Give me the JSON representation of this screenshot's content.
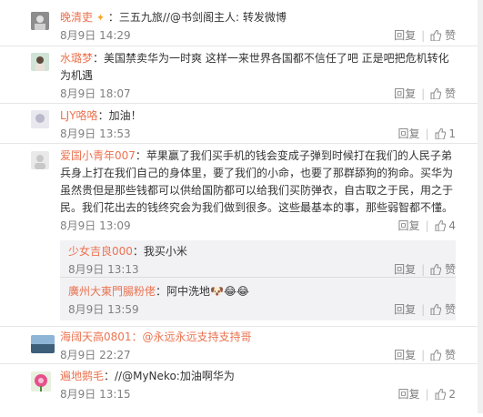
{
  "comments": [
    {
      "user": "晚清吏",
      "badge": "✦",
      "text": "：三五九旅//@书剑阁主人: 转发微博",
      "time": "8月9日 14:29",
      "reply": "回复",
      "like": "赞",
      "like_count": ""
    },
    {
      "user": "水璐梦",
      "badge": "",
      "text": "：美国禁卖华为一时爽 这样一来世界各国都不信任了吧 正是吧把危机转化为机遇",
      "time": "8月9日 18:07",
      "reply": "回复",
      "like": "赞",
      "like_count": ""
    },
    {
      "user": "LJY咯咯",
      "badge": "",
      "text": "：加油！",
      "time": "8月9日 13:53",
      "reply": "回复",
      "like": "",
      "like_count": "1"
    },
    {
      "user": "爱国小青年007",
      "badge": "",
      "text": "：苹果赢了我们买手机的钱会变成子弹到时候打在我们的人民子弟兵身上打在我们自己的身体里，要了我们的小命，也要了那群舔狗的狗命。买华为虽然贵但是那些钱都可以供给国防都可以给我们买防弹衣，自古取之于民，用之于民。我们花出去的钱终究会为我们做到很多。这些最基本的事，那些弱智都不懂。",
      "time": "8月9日 13:09",
      "reply": "回复",
      "like": "",
      "like_count": "4"
    },
    {
      "user": "海阔天高0801",
      "badge": "",
      "text": "：@永远永远支持支持哥",
      "time": "8月9日 22:27",
      "reply": "回复",
      "like": "赞",
      "like_count": ""
    },
    {
      "user": "遍地鹅毛",
      "badge": "",
      "text": "：//@MyNeko:加油啊华为",
      "time": "8月9日 13:15",
      "reply": "回复",
      "like": "",
      "like_count": "2"
    }
  ],
  "subreplies": [
    {
      "user": "少女吉良000",
      "text": "：我买小米",
      "time": "8月9日 13:13",
      "reply": "回复",
      "like": "赞"
    },
    {
      "user": "廣州大東門腸粉佬",
      "text": "：阿中洗地",
      "emoji": "🐶😂😂",
      "time": "8月9日 13:59",
      "reply": "回复",
      "like": "赞"
    }
  ]
}
